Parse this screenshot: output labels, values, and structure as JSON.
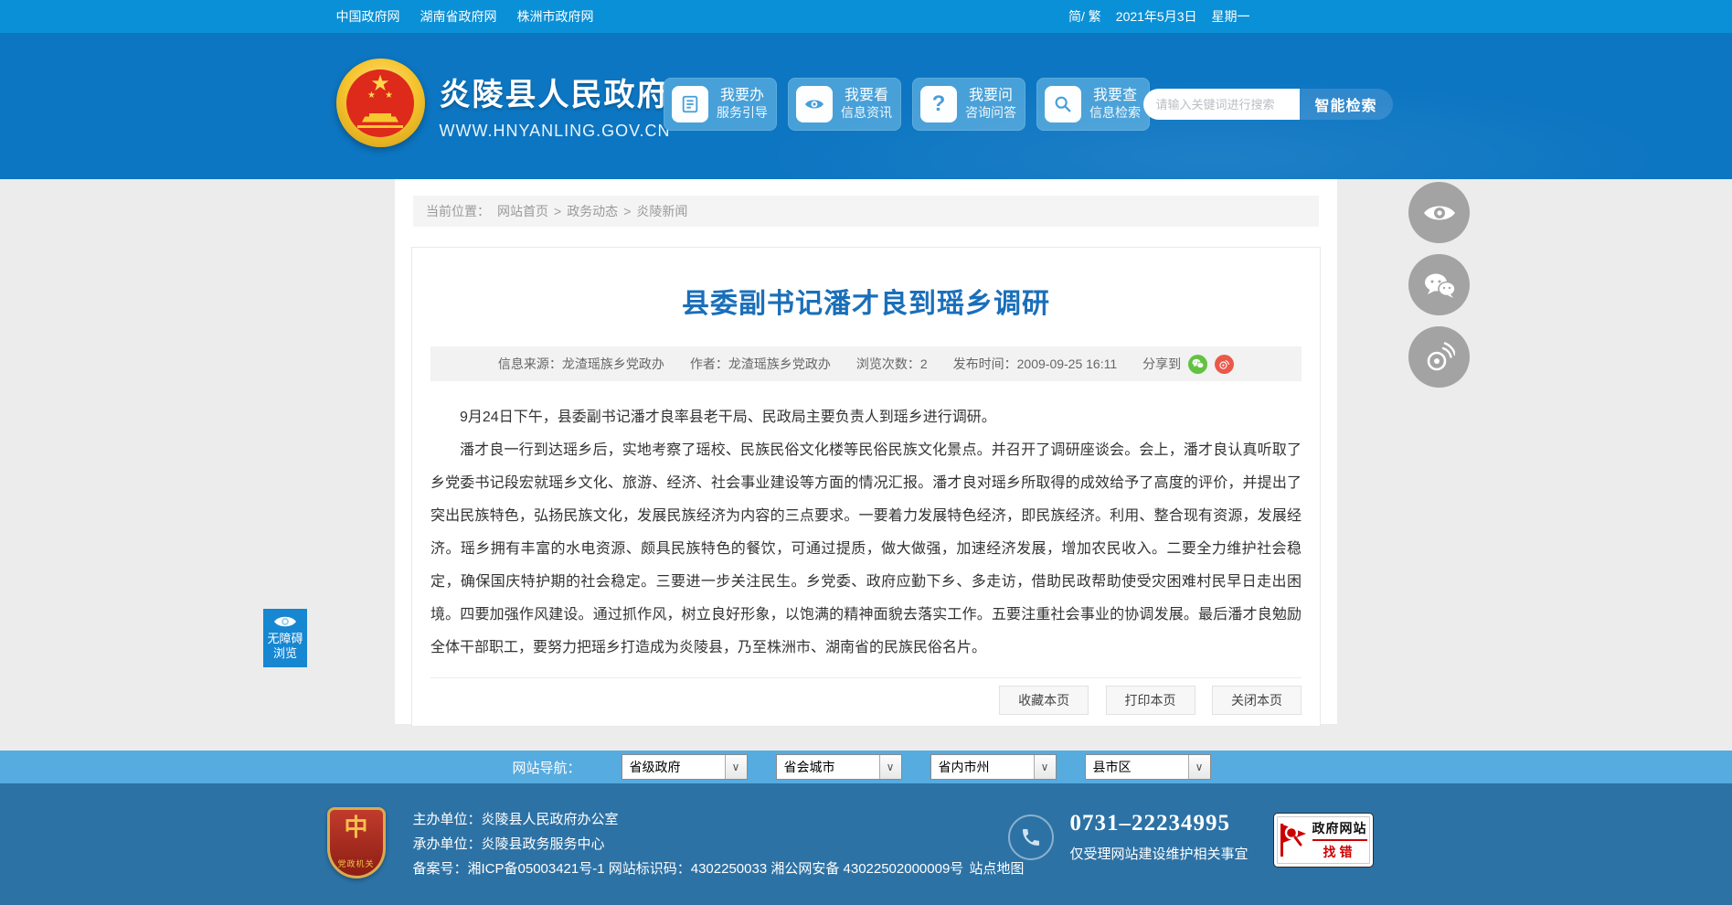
{
  "topbar": {
    "links": [
      {
        "label": "中国政府网"
      },
      {
        "label": "湖南省政府网"
      },
      {
        "label": "株洲市政府网"
      }
    ],
    "lang_toggle": "简/ 繁",
    "date": "2021年5月3日",
    "weekday": "星期一"
  },
  "header": {
    "site_name": "炎陵县人民政府",
    "site_url": "WWW.HNYANLING.GOV.CN",
    "quick_buttons": [
      {
        "icon": "document-icon",
        "line1": "我要办",
        "line2": "服务引导"
      },
      {
        "icon": "eye-icon",
        "line1": "我要看",
        "line2": "信息资讯"
      },
      {
        "icon": "question-icon",
        "line1": "我要问",
        "line2": "咨询问答"
      },
      {
        "icon": "search-icon",
        "line1": "我要查",
        "line2": "信息检索"
      }
    ],
    "search": {
      "placeholder": "请输入关键词进行搜索",
      "button": "智能检索"
    }
  },
  "breadcrumb": {
    "label": "当前位置：",
    "separator": ">",
    "items": [
      {
        "label": "网站首页"
      },
      {
        "label": "政务动态"
      },
      {
        "label": "炎陵新闻"
      }
    ]
  },
  "article": {
    "title": "县委副书记潘才良到瑶乡调研",
    "meta": {
      "source": "信息来源：龙渣瑶族乡党政办",
      "author": "作者：龙渣瑶族乡党政办",
      "views": "浏览次数：2",
      "time": "发布时间：2009-09-25 16:11",
      "share_label": "分享到",
      "share_icons": [
        {
          "name": "wechat-share-icon",
          "color": "#62c242"
        },
        {
          "name": "weibo-share-icon",
          "color": "#e9594a"
        }
      ]
    },
    "paragraphs": [
      "9月24日下午，县委副书记潘才良率县老干局、民政局主要负责人到瑶乡进行调研。",
      "潘才良一行到达瑶乡后，实地考察了瑶校、民族民俗文化楼等民俗民族文化景点。并召开了调研座谈会。会上，潘才良认真听取了乡党委书记段宏就瑶乡文化、旅游、经济、社会事业建设等方面的情况汇报。潘才良对瑶乡所取得的成效给予了高度的评价，并提出了突出民族特色，弘扬民族文化，发展民族经济为内容的三点要求。一要着力发展特色经济，即民族经济。利用、整合现有资源，发展经济。瑶乡拥有丰富的水电资源、颇具民族特色的餐饮，可通过提质，做大做强，加速经济发展，增加农民收入。二要全力维护社会稳定，确保国庆特护期的社会稳定。三要进一步关注民生。乡党委、政府应勤下乡、多走访，借助民政帮助使受灾困难村民早日走出困境。四要加强作风建设。通过抓作风，树立良好形象，以饱满的精神面貌去落实工作。五要注重社会事业的协调发展。最后潘才良勉励全体干部职工，要努力把瑶乡打造成为炎陵县，乃至株洲市、湖南省的民族民俗名片。"
    ],
    "actions": [
      {
        "label": "收藏本页"
      },
      {
        "label": "打印本页"
      },
      {
        "label": "关闭本页"
      }
    ]
  },
  "floats": {
    "accessibility": {
      "line1": "无障碍",
      "line2": "浏览"
    },
    "side_icons": [
      {
        "name": "eye-icon"
      },
      {
        "name": "wechat-icon"
      },
      {
        "name": "weibo-icon"
      }
    ]
  },
  "navbar": {
    "label": "网站导航：",
    "selects": [
      {
        "value": "省级政府"
      },
      {
        "value": "省会城市"
      },
      {
        "value": "省内市州"
      },
      {
        "value": "县市区"
      }
    ]
  },
  "footer": {
    "shield_badge": {
      "glyph": "中",
      "text": "党政机关"
    },
    "line1": "主办单位：炎陵县人民政府办公室",
    "line2": "承办单位：炎陵县政务服务中心",
    "line3": "备案号：湘ICP备05003421号-1 网站标识码：4302250033 湘公网安备 43022502000009号",
    "sitemap": "站点地图",
    "phone": "0731–22234995",
    "phone_note": "仅受理网站建设维护相关事宜",
    "error_badge": {
      "line1": "政府网站",
      "line2": "找错"
    }
  }
}
